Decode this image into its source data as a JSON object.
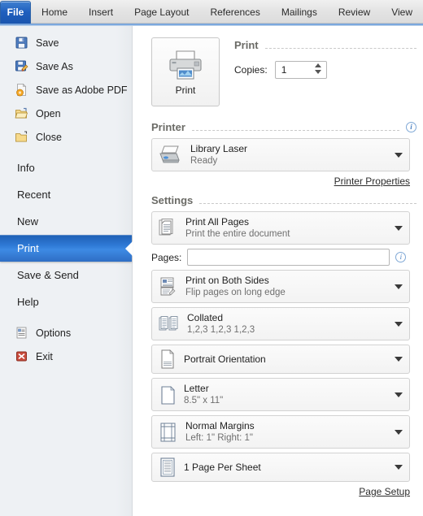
{
  "ribbon": {
    "tabs": [
      {
        "label": "File",
        "active": true
      },
      {
        "label": "Home",
        "active": false
      },
      {
        "label": "Insert",
        "active": false
      },
      {
        "label": "Page Layout",
        "active": false
      },
      {
        "label": "References",
        "active": false
      },
      {
        "label": "Mailings",
        "active": false
      },
      {
        "label": "Review",
        "active": false
      },
      {
        "label": "View",
        "active": false
      }
    ]
  },
  "sidebar": {
    "items": [
      {
        "label": "Save",
        "icon": "save-icon",
        "type": "icon"
      },
      {
        "label": "Save As",
        "icon": "save-as-icon",
        "type": "icon"
      },
      {
        "label": "Save as Adobe PDF",
        "icon": "adobe-pdf-icon",
        "type": "icon"
      },
      {
        "label": "Open",
        "icon": "open-folder-icon",
        "type": "icon"
      },
      {
        "label": "Close",
        "icon": "close-folder-icon",
        "type": "icon"
      },
      {
        "label": "Info",
        "type": "plain"
      },
      {
        "label": "Recent",
        "type": "plain"
      },
      {
        "label": "New",
        "type": "plain"
      },
      {
        "label": "Print",
        "type": "plain",
        "selected": true
      },
      {
        "label": "Save & Send",
        "type": "plain"
      },
      {
        "label": "Help",
        "type": "plain"
      },
      {
        "label": "Options",
        "icon": "options-icon",
        "type": "icon"
      },
      {
        "label": "Exit",
        "icon": "exit-icon",
        "type": "icon"
      }
    ],
    "selected_accent": "#2f7ad6"
  },
  "print_section": {
    "heading": "Print",
    "button_label": "Print",
    "copies_label": "Copies:",
    "copies_value": "1"
  },
  "printer_section": {
    "heading": "Printer",
    "name": "Library Laser",
    "status": "Ready",
    "properties_link": "Printer Properties"
  },
  "settings_section": {
    "heading": "Settings",
    "rows": [
      {
        "title": "Print All Pages",
        "subtitle": "Print the entire document",
        "icon": "pages-stack-icon"
      },
      {
        "title": "Print on Both Sides",
        "subtitle": "Flip pages on long edge",
        "icon": "duplex-icon"
      },
      {
        "title": "Collated",
        "subtitle": "1,2,3   1,2,3   1,2,3",
        "icon": "collate-icon"
      },
      {
        "title": "Portrait Orientation",
        "subtitle": "",
        "icon": "portrait-icon"
      },
      {
        "title": "Letter",
        "subtitle": "8.5\" x 11\"",
        "icon": "paper-size-icon"
      },
      {
        "title": "Normal Margins",
        "subtitle": "Left: 1\"   Right: 1\"",
        "icon": "margins-icon"
      },
      {
        "title": "1 Page Per Sheet",
        "subtitle": "",
        "icon": "pages-per-sheet-icon"
      }
    ],
    "pages_label": "Pages:",
    "pages_value": "",
    "pages_placeholder": "",
    "page_setup_link": "Page Setup"
  }
}
